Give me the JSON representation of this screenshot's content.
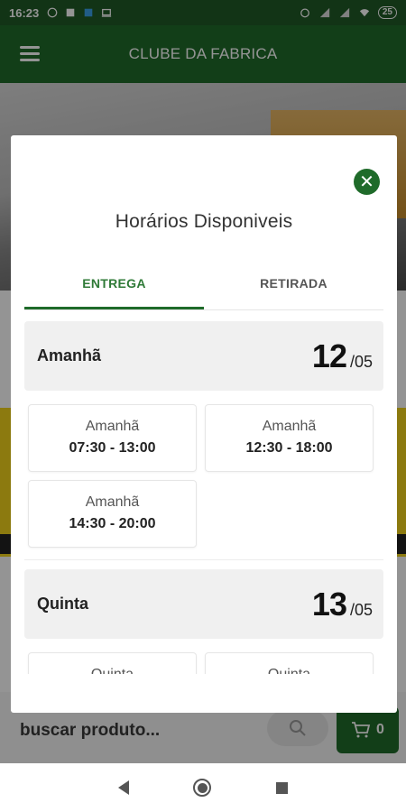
{
  "status_bar": {
    "time": "16:23",
    "battery": "25",
    "icons": [
      "whatsapp-icon",
      "app-icon",
      "notification-icon",
      "laptop-icon",
      "alarm-icon",
      "signal-icon",
      "signal-icon",
      "wifi-icon"
    ]
  },
  "app_bar": {
    "title": "CLUBE DA FABRICA",
    "menu_icon": "hamburger-menu-icon"
  },
  "background": {
    "search_placeholder": "buscar produto...",
    "cart_count": "0"
  },
  "modal": {
    "title": "Horários Disponiveis",
    "tabs": [
      {
        "label": "ENTREGA",
        "active": true
      },
      {
        "label": "RETIRADA",
        "active": false
      }
    ],
    "days": [
      {
        "name": "Amanhã",
        "day": "12",
        "month": "/05",
        "slots": [
          {
            "day": "Amanhã",
            "time": "07:30 - 13:00"
          },
          {
            "day": "Amanhã",
            "time": "12:30 - 18:00"
          },
          {
            "day": "Amanhã",
            "time": "14:30 - 20:00"
          }
        ]
      },
      {
        "name": "Quinta",
        "day": "13",
        "month": "/05",
        "slots": [
          {
            "day": "Quinta",
            "time": ""
          },
          {
            "day": "Quinta",
            "time": ""
          }
        ]
      }
    ]
  },
  "colors": {
    "primary": "#1f6b2a",
    "status_bar": "#1f5a26",
    "tab_active": "#2f7a37",
    "day_header_bg": "#f0f0f0"
  }
}
